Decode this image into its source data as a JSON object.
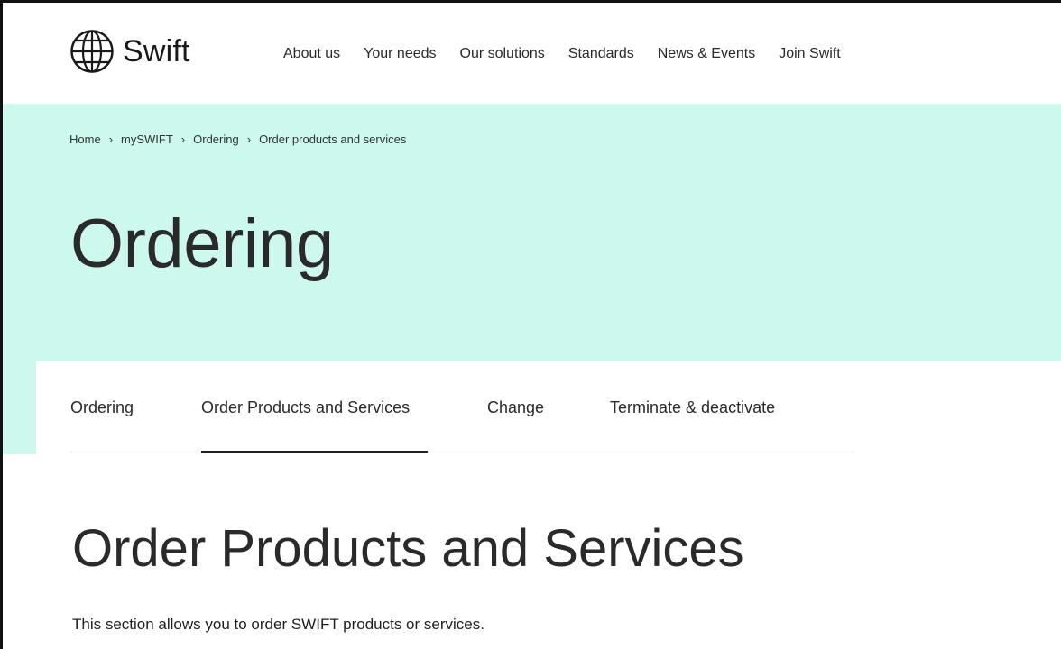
{
  "brand": {
    "name": "Swift",
    "accent": "#cdf8ee",
    "icon": "globe-icon"
  },
  "nav": {
    "items": [
      {
        "label": "About us"
      },
      {
        "label": "Your needs"
      },
      {
        "label": "Our solutions"
      },
      {
        "label": "Standards"
      },
      {
        "label": "News & Events"
      },
      {
        "label": "Join Swift"
      }
    ]
  },
  "breadcrumb": {
    "items": [
      {
        "label": "Home"
      },
      {
        "label": "mySWIFT"
      },
      {
        "label": "Ordering"
      },
      {
        "label": "Order products and services"
      }
    ],
    "separator": "›"
  },
  "hero": {
    "title": "Ordering"
  },
  "tabs": {
    "items": [
      {
        "label": "Ordering",
        "active": false
      },
      {
        "label": "Order Products and Services",
        "active": true
      },
      {
        "label": "Change",
        "active": false
      },
      {
        "label": "Terminate & deactivate",
        "active": false
      }
    ]
  },
  "section": {
    "title": "Order Products and Services",
    "description": "This section allows you to order SWIFT products or services."
  }
}
